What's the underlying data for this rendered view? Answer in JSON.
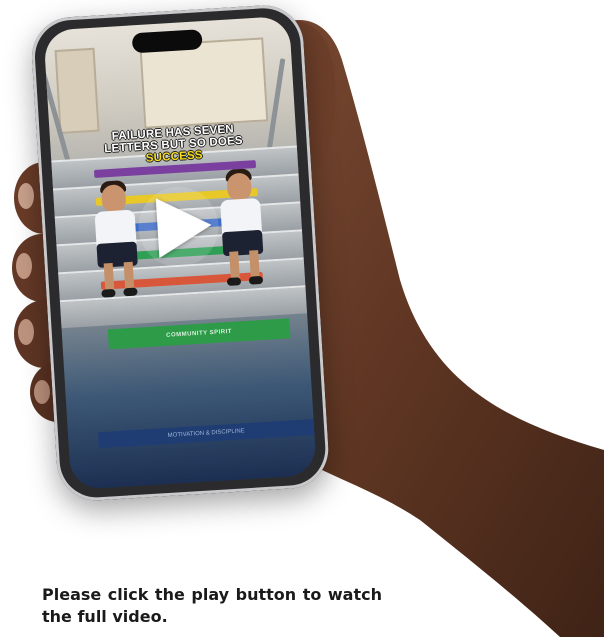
{
  "video": {
    "caption_line1": "FAILURE HAS SEVEN",
    "caption_line2": "LETTERS BUT SO DOES",
    "caption_highlight": "SUCCESS",
    "banner_community": "COMMUNITY SPIRIT",
    "banner_bottom": "MOTIVATION & DISCIPLINE",
    "highlight_color": "#f5dd1c",
    "play_icon": "play-icon"
  },
  "notice": {
    "text": "Please click the play button to watch the full video."
  }
}
